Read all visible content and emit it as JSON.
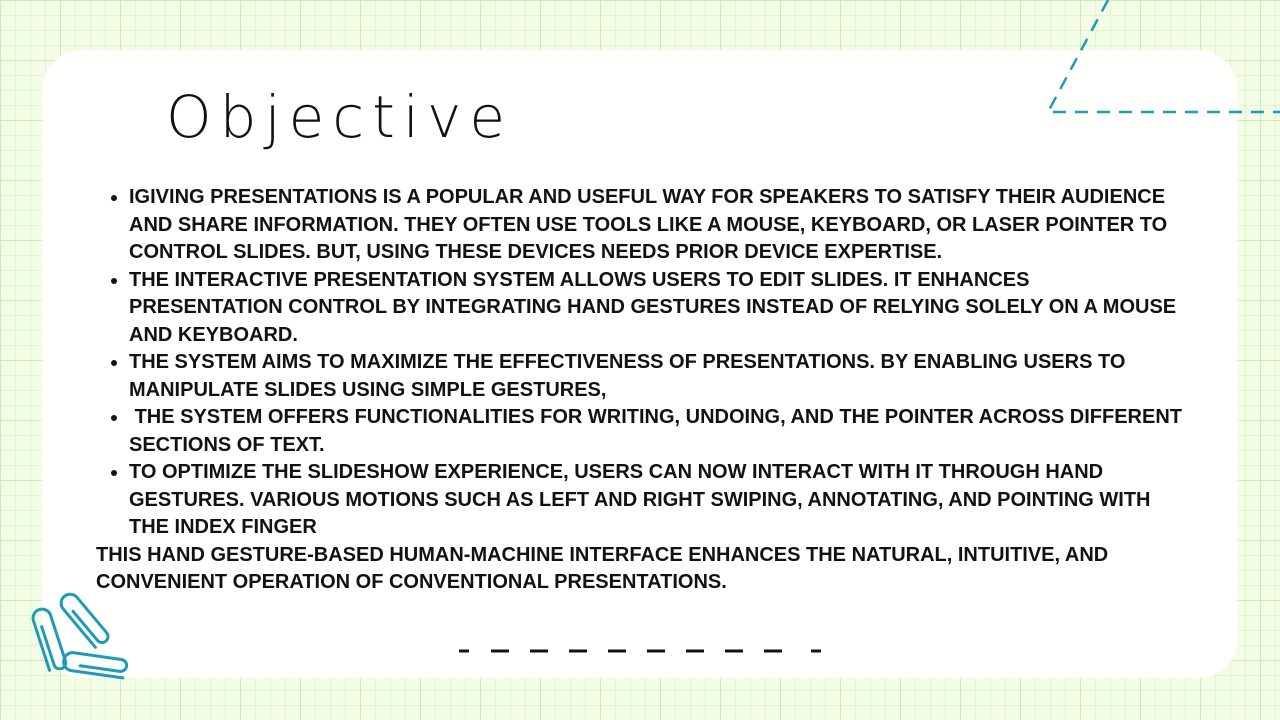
{
  "slide": {
    "title": "Objective",
    "bullets": [
      "iGiving presentations is a popular and useful way for speakers to satisfy their audience and share information. They often use tools like a mouse, keyboard, or laser pointer to control slides. But, using these devices needs prior device expertise.",
      "The interactive presentation system allows users to edit slides. It enhances presentation control by integrating hand gestures instead of relying solely on a mouse and keyboard.",
      "The system aims to maximize the effectiveness of presentations. By enabling users to manipulate slides using simple gestures,",
      " The system offers functionalities for writing, undoing, and the pointer across different sections of text.",
      "To optimize the slideshow experience, users can now interact with it through hand gestures. Various motions such as left and right swiping, annotating, and pointing with the index finger"
    ],
    "closing": "This hand gesture-based human-machine interface enhances the natural, intuitive, and convenient operation of conventional presentations."
  },
  "decorations": {
    "background": "green-grid-paper",
    "corner_dashed_lines": "dashed-line-icon",
    "paperclips": "paperclip-icon",
    "divider": "dashed-divider",
    "accent_color": "#1f9bb8",
    "card_color": "#fffffe",
    "grid_color": "#c7eeb5"
  }
}
